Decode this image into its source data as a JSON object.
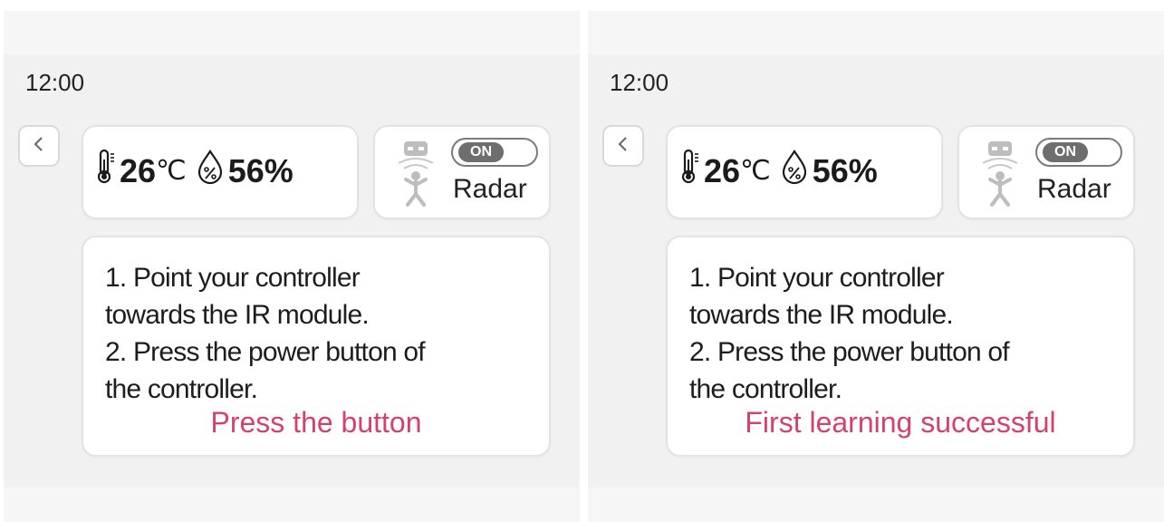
{
  "colors": {
    "status_text": "#d6416b",
    "card_bg": "#ffffff",
    "panel_bg": "#f1f1f1",
    "toggle_knob": "#6e6e6e"
  },
  "screens": [
    {
      "time": "12:00",
      "temperature": {
        "value": "26",
        "unit": "℃",
        "icon": "thermometer-icon"
      },
      "humidity": {
        "value": "56%",
        "icon": "humidity-drop-icon"
      },
      "radar": {
        "toggle_label": "ON",
        "label": "Radar",
        "icon": "radar-person-icon"
      },
      "instructions": [
        "1. Point your controller",
        "towards the IR module.",
        "2. Press the power button of",
        "the controller."
      ],
      "status": "Press the button"
    },
    {
      "time": "12:00",
      "temperature": {
        "value": "26",
        "unit": "℃",
        "icon": "thermometer-icon"
      },
      "humidity": {
        "value": "56%",
        "icon": "humidity-drop-icon"
      },
      "radar": {
        "toggle_label": "ON",
        "label": "Radar",
        "icon": "radar-person-icon"
      },
      "instructions": [
        "1. Point your controller",
        "towards the IR module.",
        "2. Press the power button of",
        "the controller."
      ],
      "status": "First learning successful"
    }
  ]
}
